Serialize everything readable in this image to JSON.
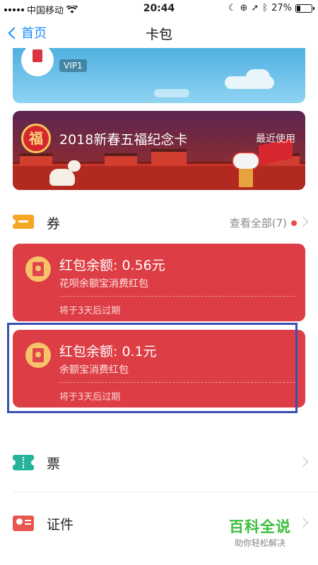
{
  "status_bar": {
    "carrier": "中国移动",
    "time": "20:44",
    "battery_percent": "27%",
    "battery_level": 0.27
  },
  "nav": {
    "back_label": "首页",
    "title": "卡包"
  },
  "top_card": {
    "vip_label": "VIP1",
    "color": "#4fb0e0"
  },
  "fu_card": {
    "logo_char": "福",
    "title": "2018新春五福纪念卡",
    "recent_label": "最近使用"
  },
  "coupons": {
    "title": "券",
    "view_all": "查看全部(7)",
    "items": [
      {
        "amount": "红包余额: 0.56元",
        "description": "花呗余额宝消费红包",
        "expiry": "将于3天后过期"
      },
      {
        "amount": "红包余额: 0.1元",
        "description": "余额宝消费红包",
        "expiry": "将于3天后过期"
      }
    ],
    "card_color": "#dd3d44",
    "highlight_color": "#3b4fb5"
  },
  "tickets": {
    "title": "票"
  },
  "ids": {
    "title": "证件"
  },
  "watermark": {
    "title": "百科全说",
    "subtitle": "助你轻松解决"
  }
}
